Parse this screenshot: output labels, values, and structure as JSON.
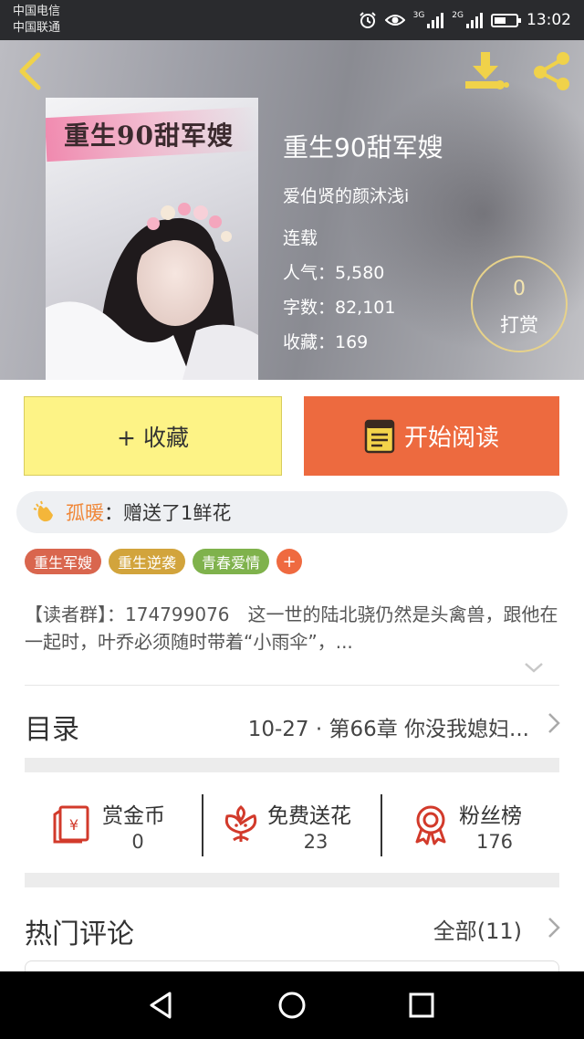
{
  "status_bar": {
    "carrier_1": "中国电信",
    "carrier_2": "中国联通",
    "signal_1_label": "3G",
    "signal_2_label": "2G",
    "time": "13:02",
    "battery_level": 0.55
  },
  "book": {
    "cover_title": "重生90甜军嫂",
    "title": "重生90甜军嫂",
    "author": "爱伯贤的颜沐浅i",
    "status": "连载",
    "popularity": "人气：5,580",
    "word_count": "字数：82,101",
    "favorites": "收藏：169",
    "tip_count": "0",
    "tip_label": "打赏"
  },
  "actions": {
    "collect_label": "+ 收藏",
    "read_label": "开始阅读"
  },
  "gift_banner": {
    "user": "孤暖",
    "message": "：赠送了1鲜花"
  },
  "tags": [
    {
      "label": "重生军嫂",
      "color": "#d9664e"
    },
    {
      "label": "重生逆袭",
      "color": "#d2a43c"
    },
    {
      "label": "青春爱情",
      "color": "#7fb24c"
    }
  ],
  "tag_add": "+",
  "synopsis": "【读者群】：174799076　这一世的陆北骁仍然是头禽兽，跟他在一起时，叶乔必须随时带着“小雨伞”，...",
  "toc": {
    "label": "目录",
    "latest": "10-27 · 第66章  你没我媳妇..."
  },
  "stats": [
    {
      "name": "赏金币",
      "value": "0",
      "icon": "red-envelope-icon"
    },
    {
      "name": "免费送花",
      "value": "23",
      "icon": "flower-icon"
    },
    {
      "name": "粉丝榜",
      "value": "176",
      "icon": "award-ribbon-icon"
    }
  ],
  "comments": {
    "label": "热门评论",
    "all": "全部(11)"
  },
  "colors": {
    "collect_bg": "#fdf386",
    "read_bg": "#ed6a3f",
    "accent_icon": "#f0d24a",
    "stat_icon": "#d23a2b"
  }
}
